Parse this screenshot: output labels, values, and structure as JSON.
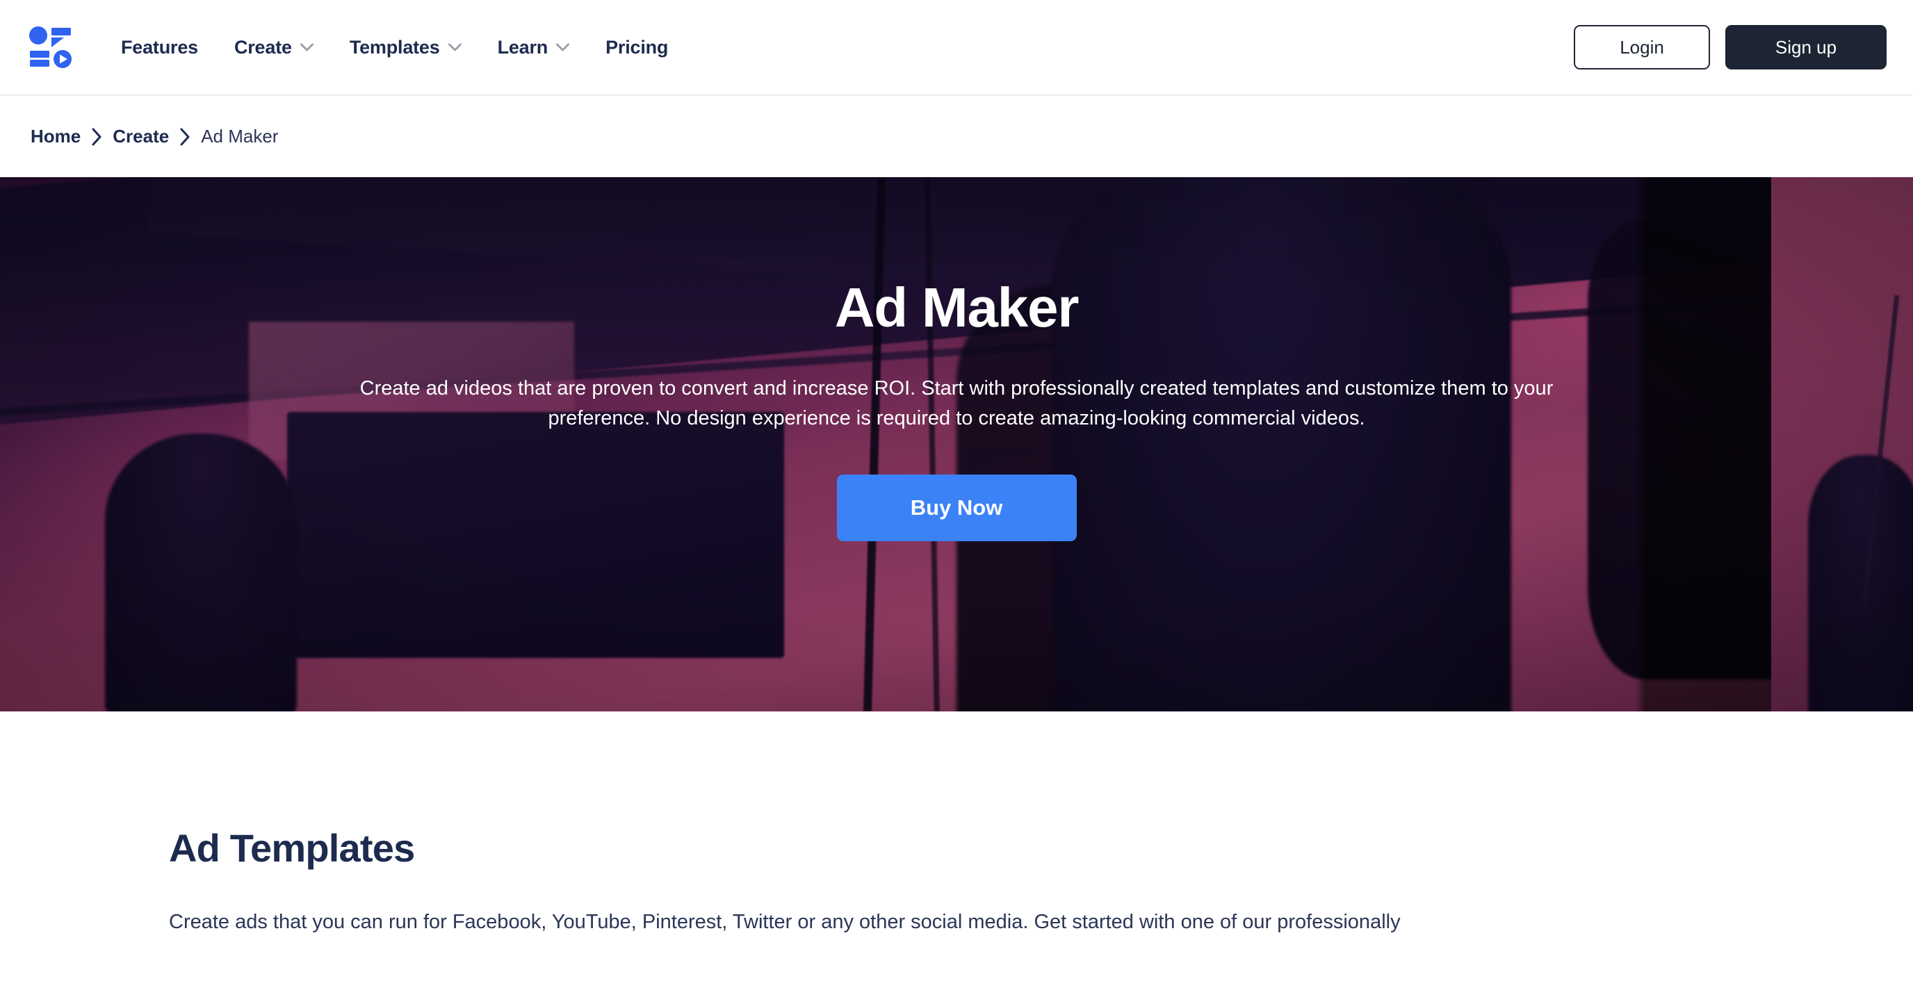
{
  "header": {
    "logo_name": "flexclip-logo",
    "nav": [
      {
        "label": "Features",
        "has_dropdown": false
      },
      {
        "label": "Create",
        "has_dropdown": true
      },
      {
        "label": "Templates",
        "has_dropdown": true
      },
      {
        "label": "Learn",
        "has_dropdown": true
      },
      {
        "label": "Pricing",
        "has_dropdown": false
      }
    ],
    "login_label": "Login",
    "signup_label": "Sign up"
  },
  "breadcrumb": {
    "items": [
      {
        "label": "Home",
        "current": false
      },
      {
        "label": "Create",
        "current": false
      },
      {
        "label": "Ad Maker",
        "current": true
      }
    ],
    "separator_icon": "chevron-right-icon"
  },
  "hero": {
    "title": "Ad Maker",
    "description": "Create ad videos that are proven to convert and increase ROI. Start with professionally created templates and customize them to your preference. No design experience is required to create amazing-looking commercial videos.",
    "cta_label": "Buy Now"
  },
  "templates_section": {
    "title": "Ad Templates",
    "description": "Create ads that you can run for Facebook, YouTube, Pinterest, Twitter or any other social media. Get started with one of our professionally"
  },
  "colors": {
    "brand_blue": "#2f63f0",
    "cta_blue": "#3b82f6",
    "navy": "#1d2b4f",
    "dark": "#1d2433",
    "hero_magenta": "#8c3a61",
    "hero_dark": "#120b26",
    "white": "#ffffff",
    "chevron_gray": "#9aa0ab",
    "border_gray": "#eceef1"
  }
}
